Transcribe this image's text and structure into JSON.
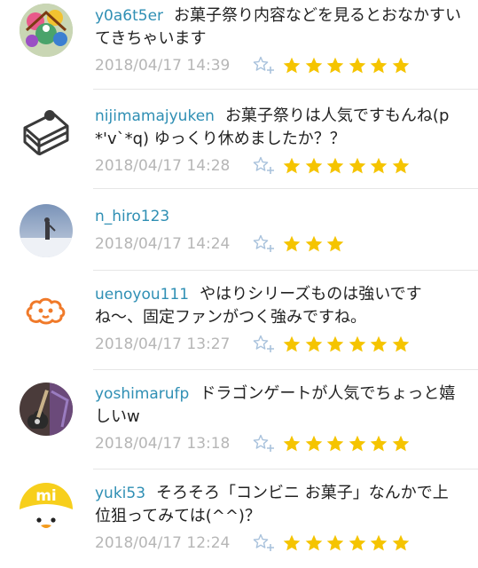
{
  "colors": {
    "username": "#2f8fb4",
    "timestamp": "#b6b6b6",
    "star": "#f5c400",
    "fav_icon": "#a9c2dc",
    "divider": "#e6e6e6"
  },
  "comments": [
    {
      "username": "y0a6t5er",
      "text": "お菓子祭り内容などを見るとおなかすいてきちゃいます",
      "timestamp": "2018/04/17 14:39",
      "rating": 6,
      "avatar_icon": "colorful-art-avatar-icon"
    },
    {
      "username": "nijimamajyuken",
      "text": "お菓子祭りは人気ですもんね(p*'v`*q) ゆっくり休めましたか？？",
      "timestamp": "2018/04/17 14:28",
      "rating": 6,
      "avatar_icon": "cake-avatar-icon"
    },
    {
      "username": "n_hiro123",
      "text": "",
      "timestamp": "2018/04/17 14:24",
      "rating": 3,
      "avatar_icon": "snow-landscape-avatar-icon"
    },
    {
      "username": "uenoyou111",
      "text": "やはりシリーズものは強いですね〜、固定ファンがつく強みですね。",
      "timestamp": "2018/04/17 13:27",
      "rating": 6,
      "avatar_icon": "orange-face-avatar-icon"
    },
    {
      "username": "yoshimarufp",
      "text": "ドラゴンゲートが人気でちょっと嬉しいw",
      "timestamp": "2018/04/17 13:18",
      "rating": 6,
      "avatar_icon": "guitar-avatar-icon"
    },
    {
      "username": "yuki53",
      "text": "そろそろ「コンビニ お菓子」なんかで上位狙ってみては(^^)？",
      "timestamp": "2018/04/17 12:24",
      "rating": 6,
      "avatar_icon": "mi-chick-avatar-icon"
    }
  ]
}
